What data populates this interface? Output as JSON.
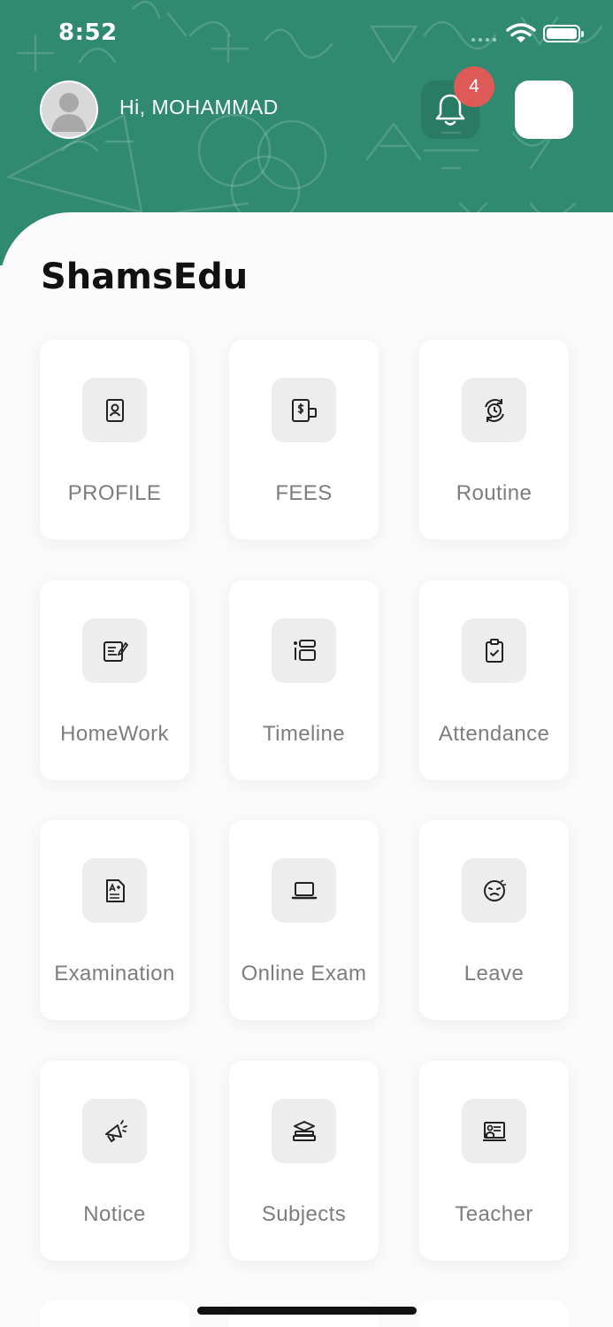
{
  "status_bar": {
    "time": "8:52"
  },
  "header": {
    "greeting": "Hi, MOHAMMAD",
    "notification_count": "4",
    "accent_color": "#2f8a6f",
    "badge_color": "#dd5a56"
  },
  "app": {
    "brand": "ShamsEdu"
  },
  "menu": [
    {
      "label": "PROFILE",
      "icon": "profile-icon"
    },
    {
      "label": "FEES",
      "icon": "fees-icon"
    },
    {
      "label": "Routine",
      "icon": "routine-icon"
    },
    {
      "label": "HomeWork",
      "icon": "homework-icon"
    },
    {
      "label": "Timeline",
      "icon": "timeline-icon"
    },
    {
      "label": "Attendance",
      "icon": "attendance-icon"
    },
    {
      "label": "Examination",
      "icon": "examination-icon"
    },
    {
      "label": "Online Exam",
      "icon": "online-exam-icon"
    },
    {
      "label": "Leave",
      "icon": "leave-icon"
    },
    {
      "label": "Notice",
      "icon": "notice-icon"
    },
    {
      "label": "Subjects",
      "icon": "subjects-icon"
    },
    {
      "label": "Teacher",
      "icon": "teacher-icon"
    }
  ]
}
